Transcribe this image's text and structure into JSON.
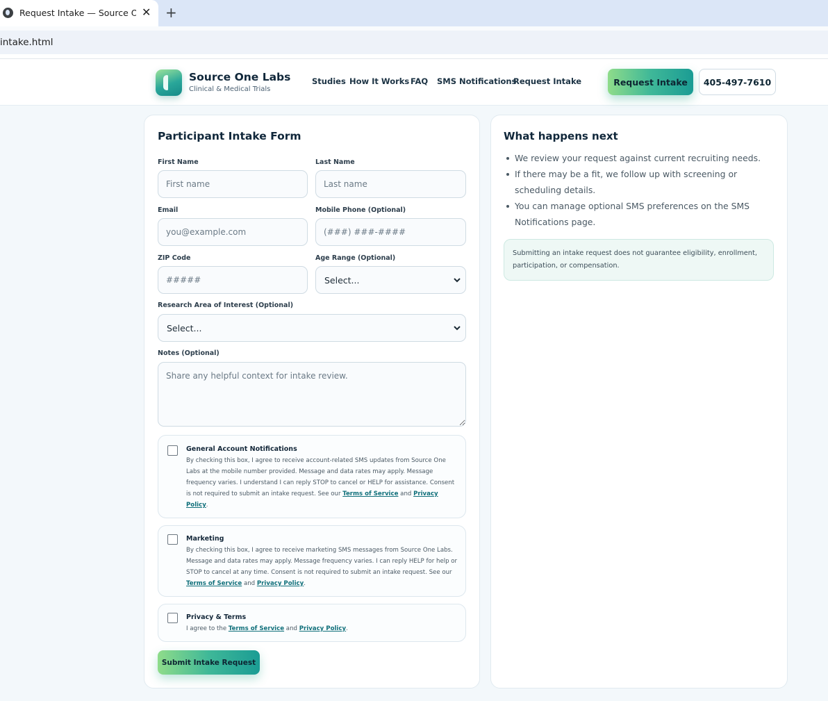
{
  "browser": {
    "tab_title": "Request Intake — Source One Labs",
    "close_glyph": "✕",
    "new_tab_glyph": "+",
    "address": "intake.html"
  },
  "header": {
    "brand_name": "Source One Labs",
    "brand_tagline": "Clinical & Medical Trials",
    "nav": [
      "Studies",
      "How It Works",
      "FAQ",
      "SMS Notifications",
      "Request Intake"
    ],
    "cta_label": "Request Intake",
    "phone": "405-497-7610"
  },
  "form": {
    "title": "Participant Intake Form",
    "first_name": {
      "label": "First Name",
      "placeholder": "First name"
    },
    "last_name": {
      "label": "Last Name",
      "placeholder": "Last name"
    },
    "email": {
      "label": "Email",
      "placeholder": "you@example.com"
    },
    "phone": {
      "label": "Mobile Phone (Optional)",
      "placeholder": "(###) ###-####"
    },
    "zip": {
      "label": "ZIP Code",
      "placeholder": "#####"
    },
    "age_range": {
      "label": "Age Range (Optional)",
      "selected": "Select..."
    },
    "research_area": {
      "label": "Research Area of Interest (Optional)",
      "selected": "Select..."
    },
    "notes": {
      "label": "Notes (Optional)",
      "placeholder": "Share any helpful context for intake review."
    },
    "consents": [
      {
        "title": "General Account Notifications",
        "checked": false,
        "text": "By checking this box, I agree to receive account-related SMS updates from Source One Labs at the mobile number provided. Message and data rates may apply. Message frequency varies. I understand I can reply STOP to cancel or HELP for assistance. Consent is not required to submit an intake request. See our",
        "link1": "Terms of Service",
        "joiner": "and",
        "link2": "Privacy Policy",
        "end": "."
      },
      {
        "title": "Marketing",
        "checked": false,
        "text": "By checking this box, I agree to receive marketing SMS messages from Source One Labs. Message and data rates may apply. Message frequency varies. I can reply HELP for help or STOP to cancel at any time. Consent is not required to submit an intake request. See our",
        "link1": "Terms of Service",
        "joiner": "and",
        "link2": "Privacy Policy",
        "end": "."
      },
      {
        "title": "Privacy & Terms",
        "checked": false,
        "text": "I agree to the",
        "link1": "Terms of Service",
        "joiner": "and",
        "link2": "Privacy Policy",
        "end": "."
      }
    ],
    "submit_label": "Submit Intake Request"
  },
  "sidebar": {
    "title": "What happens next",
    "bullets": [
      "We review your request against current recruiting needs.",
      "If there may be a fit, we follow up with screening or scheduling details.",
      "You can manage optional SMS preferences on the SMS Notifications page."
    ],
    "notice": "Submitting an intake request does not guarantee eligibility, enrollment, participation, or compensation."
  }
}
